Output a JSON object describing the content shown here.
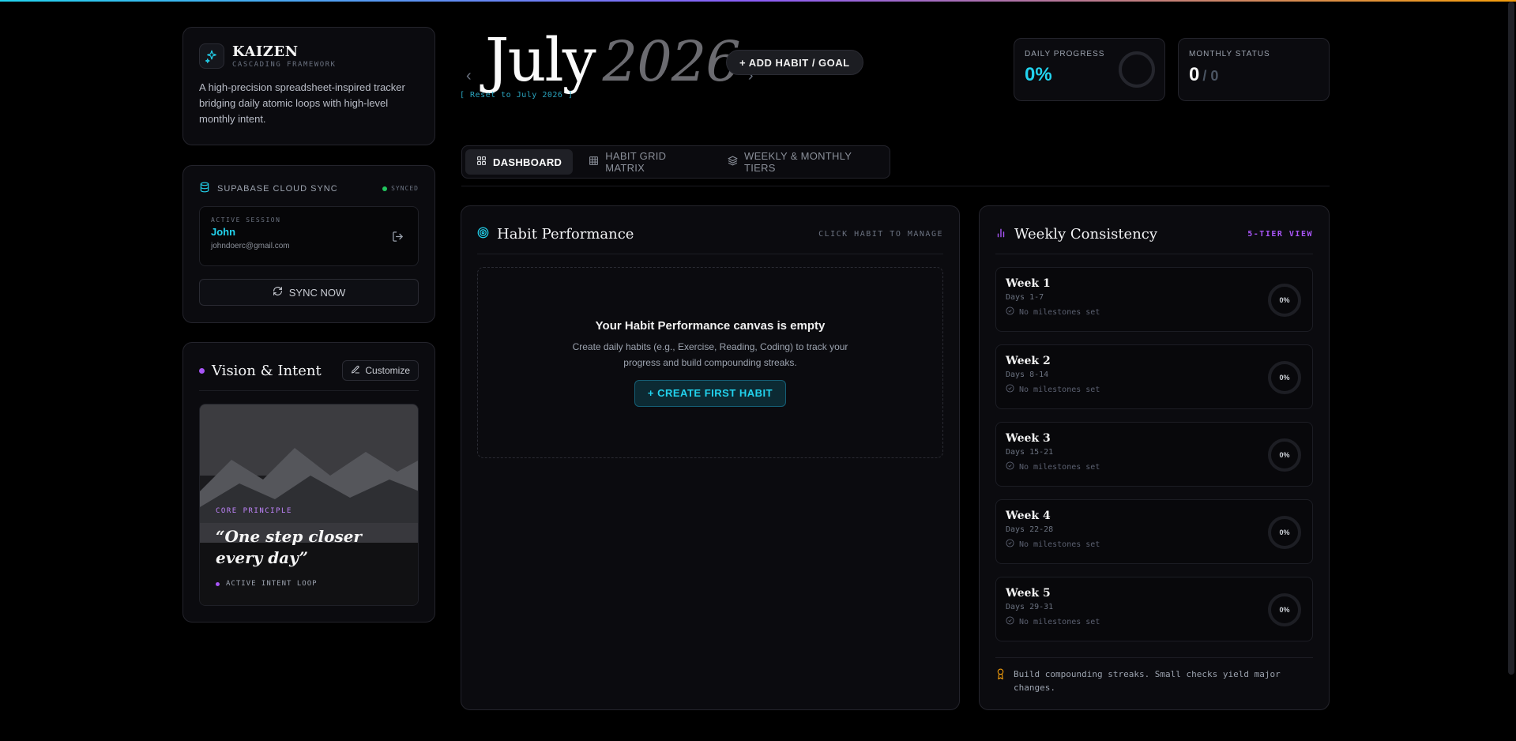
{
  "brand": {
    "title": "KAIZEN",
    "subtitle": "CASCADING FRAMEWORK",
    "description": "A high-precision spreadsheet-inspired tracker bridging daily atomic loops with high-level monthly intent."
  },
  "sync": {
    "title": "SUPABASE CLOUD SYNC",
    "status": "SYNCED",
    "session_label": "ACTIVE SESSION",
    "user_name": "John",
    "user_email": "johndoerc@gmail.com",
    "button_label": "SYNC NOW"
  },
  "vision": {
    "title": "Vision & Intent",
    "customize_label": "Customize",
    "principle_label": "CORE PRINCIPLE",
    "quote": "“One step closer every day”",
    "loop_label": "ACTIVE INTENT LOOP"
  },
  "header": {
    "month": "July",
    "year": "2026",
    "prev_icon": "‹",
    "next_icon": "›",
    "reset_label": "[ Reset to July 2026 ]",
    "add_button": "+ ADD HABIT / GOAL"
  },
  "stats": {
    "daily_label": "DAILY PROGRESS",
    "daily_value": "0%",
    "monthly_label": "MONTHLY STATUS",
    "monthly_done": "0",
    "monthly_total": "/ 0"
  },
  "tabs": [
    {
      "label": "DASHBOARD",
      "icon": "grid-icon"
    },
    {
      "label": "HABIT GRID MATRIX",
      "icon": "table-icon"
    },
    {
      "label": "WEEKLY & MONTHLY TIERS",
      "icon": "layers-icon"
    }
  ],
  "performance": {
    "title": "Habit Performance",
    "hint": "CLICK HABIT TO MANAGE",
    "empty_title": "Your Habit Performance canvas is empty",
    "empty_desc": "Create daily habits (e.g., Exercise, Reading, Coding) to track your progress and build compounding streaks.",
    "create_button": "+ CREATE FIRST HABIT"
  },
  "weekly": {
    "title": "Weekly Consistency",
    "tier_label": "5-TIER VIEW",
    "weeks": [
      {
        "name": "Week 1",
        "days": "Days 1-7",
        "milestones": "No milestones set",
        "percent": "0%"
      },
      {
        "name": "Week 2",
        "days": "Days 8-14",
        "milestones": "No milestones set",
        "percent": "0%"
      },
      {
        "name": "Week 3",
        "days": "Days 15-21",
        "milestones": "No milestones set",
        "percent": "0%"
      },
      {
        "name": "Week 4",
        "days": "Days 22-28",
        "milestones": "No milestones set",
        "percent": "0%"
      },
      {
        "name": "Week 5",
        "days": "Days 29-31",
        "milestones": "No milestones set",
        "percent": "0%"
      }
    ],
    "footer": "Build compounding streaks. Small checks yield major changes."
  },
  "colors": {
    "accent_cyan": "#22d3ee",
    "accent_purple": "#a855f7",
    "accent_amber": "#f59e0b",
    "success_green": "#22c55e"
  }
}
